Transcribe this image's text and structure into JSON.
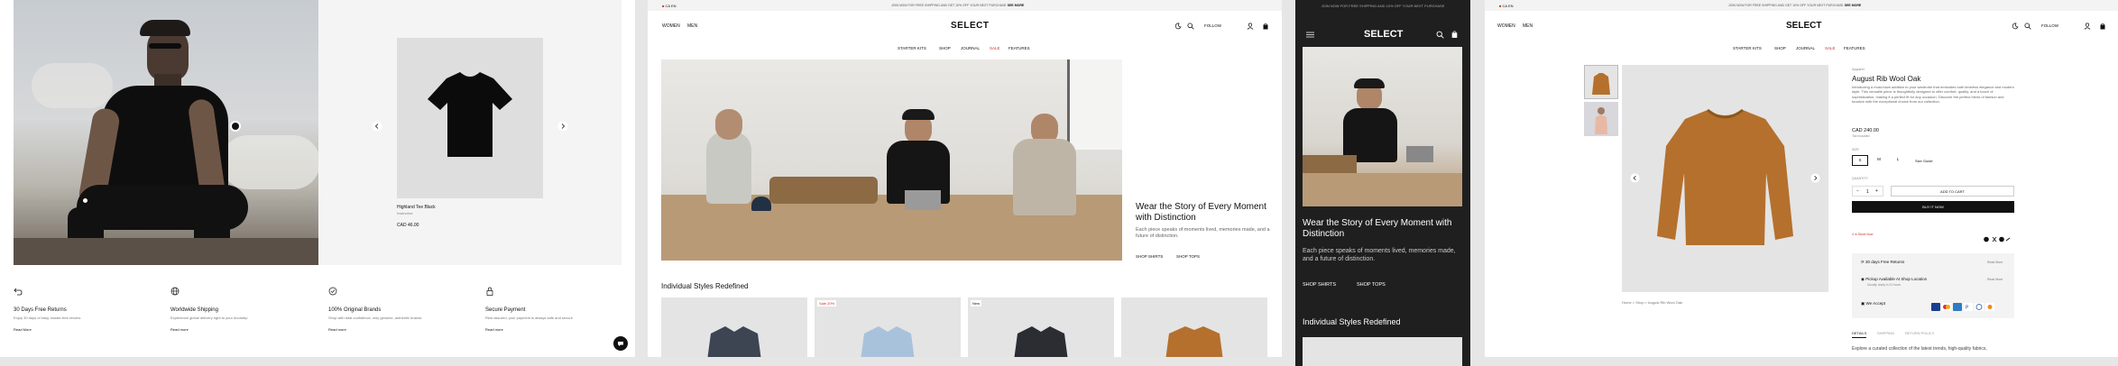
{
  "panel1": {
    "product": {
      "name": "Highland Tee Black",
      "brand": "Instinctive",
      "price": "CAD 46.00"
    },
    "features": [
      {
        "icon": "return-arrow-icon",
        "title": "30 Days Free Returns",
        "desc": "Enjoy 30 days of easy, hassle-free returns",
        "link": "Read More"
      },
      {
        "icon": "globe-icon",
        "title": "Worldwide Shipping",
        "desc": "Experience global delivery right to your doorstep",
        "link": "Read more"
      },
      {
        "icon": "check-circle-icon",
        "title": "100% Original Brands",
        "desc": "Shop with total confidence, only genuine, authentic brands",
        "link": "Read more"
      },
      {
        "icon": "lock-icon",
        "title": "Secure Payment",
        "desc": "Rest assured, your payment is always safe and secure",
        "link": "Read more"
      }
    ]
  },
  "panel2": {
    "announcement": "JOIN NOW FOR FREE SHIPPING AND GET 10% OFF YOUR NEXT PURCHASE",
    "announcement_link": "SEE MORE",
    "locale": "CA",
    "lang": "EN",
    "nav_left": [
      "WOMEN",
      "MEN"
    ],
    "logo": "SELECT",
    "follow": "FOLLOW",
    "menu": [
      "STARTER KITS",
      "SHOP",
      "JOURNAL",
      "SALE",
      "FEATURES"
    ],
    "hero_title": "Wear the Story of Every Moment with Distinction",
    "hero_desc": "Each piece speaks of moments lived, memories made, and a future of distinction.",
    "hero_links": [
      "SHOP SHIRTS",
      "SHOP TOPS"
    ],
    "section_title": "Individual Styles Redefined",
    "badges": [
      "Sale 20%",
      "New"
    ]
  },
  "panel3": {
    "announcement": "JOIN NOW FOR FREE SHIPPING AND 10% OFF YOUR NEXT PURCHASE",
    "logo": "SELECT",
    "hero_title": "Wear the Story of Every Moment with Distinction",
    "hero_desc": "Each piece speaks of moments lived, memories made, and a future of distinction.",
    "links": [
      "SHOP SHIRTS",
      "SHOP TOPS"
    ],
    "section_title": "Individual Styles Redefined"
  },
  "panel4": {
    "announcement": "JOIN NOW FOR FREE SHIPPING AND GET 10% OFF YOUR NEXT PURCHASE",
    "announcement_link": "SEE MORE",
    "locale": "CA",
    "lang": "EN",
    "nav_left": [
      "WOMEN",
      "MEN"
    ],
    "logo": "SELECT",
    "follow": "FOLLOW",
    "menu": [
      "STARTER KITS",
      "SHOP",
      "JOURNAL",
      "SALE",
      "FEATURES"
    ],
    "breadcrumb": "Home  >  Shop  >  August Rib Wool Oak",
    "brand": "Apparel",
    "title": "August Rib Wool Oak",
    "description": "Introducing a must-have addition to your wardrobe that embodies both timeless elegance and modern style. This versatile piece is thoughtfully designed to offer comfort, quality, and a touch of sophistication, making it a perfect fit for any occasion. Discover the perfect blend of fashion and function with the exceptional choice from our collection.",
    "price": "CAD 240.00",
    "tax": "Tax included.",
    "size_label": "SIZE",
    "sizes": [
      "S",
      "M",
      "L"
    ],
    "size_guide": "Size Guide",
    "qty_label": "QUANTITY",
    "qty": "1",
    "add_to_cart": "ADD TO CART",
    "buy_now": "BUY IT NOW",
    "stock": "4 in Stock Now",
    "info_rows": [
      {
        "label": "30 days Free Returns",
        "link": "Read More"
      },
      {
        "label": "Pickup Available At Shop Location",
        "sub": "Usually ready in 24 hours",
        "link": "Read More"
      }
    ],
    "pay_label": "We Accept",
    "tabs": [
      "DETAILS",
      "SHIPPING",
      "RETURN POLICY"
    ],
    "details_text": "Explore a curated collection of the latest trends, high-quality fabrics,"
  },
  "colors": {
    "sale": "#c8322b",
    "dark": "#111111",
    "accent_orange": "#b5702d"
  }
}
